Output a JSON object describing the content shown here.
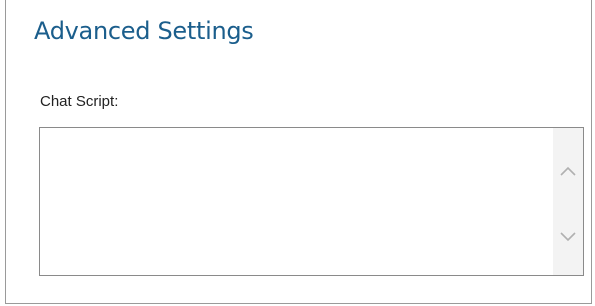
{
  "section": {
    "title": "Advanced Settings"
  },
  "chat_script": {
    "label": "Chat Script:",
    "value": "",
    "placeholder": ""
  },
  "scrollbar": {
    "up_icon": "chevron-up-icon",
    "down_icon": "chevron-down-icon"
  },
  "colors": {
    "title": "#1b5e8c",
    "border": "#8a8a8a",
    "scrollbar_track": "#f3f3f3",
    "chevron": "#b0b0b0"
  }
}
